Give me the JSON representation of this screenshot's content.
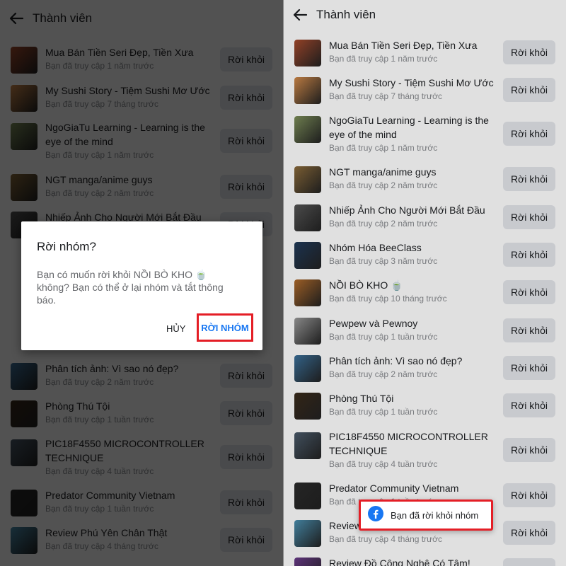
{
  "header": {
    "title": "Thành viên"
  },
  "leave_label": "Rời khỏi",
  "left_groups": [
    {
      "name": "Mua Bán Tiền Seri Đẹp, Tiền Xưa",
      "sub": "Bạn đã truy cập 1 năm trước",
      "thumb_color": "#a64a2c"
    },
    {
      "name": "My Sushi Story - Tiệm Sushi Mơ Ước",
      "sub": "Bạn đã truy cập 7 tháng trước",
      "thumb_color": "#d28a4a"
    },
    {
      "name": "NgoGiaTu Learning - Learning is the eye of the mind",
      "sub": "Bạn đã truy cập 1 năm trước",
      "thumb_color": "#7d8f5a"
    },
    {
      "name": "NGT manga/anime guys",
      "sub": "Bạn đã truy cập 2 năm trước",
      "thumb_color": "#8a6a3a"
    },
    {
      "name": "Nhiếp Ảnh Cho Người Mới Bắt Đầu",
      "sub": "",
      "thumb_color": "#555555"
    },
    {
      "name": "Phân tích ảnh: Vì sao nó đẹp?",
      "sub": "Bạn đã truy cập 2 năm trước",
      "thumb_color": "#3a6f9a"
    },
    {
      "name": "Phòng Thú Tội",
      "sub": "Bạn đã truy cập 1 tuần trước",
      "thumb_color": "#3a2a1a"
    },
    {
      "name": "PIC18F4550 MICROCONTROLLER TECHNIQUE",
      "sub": "Bạn đã truy cập 4 tuần trước",
      "thumb_color": "#4a5a6a"
    },
    {
      "name": "Predator Community Vietnam",
      "sub": "Bạn đã truy cập 1 tuần trước",
      "thumb_color": "#2a2a2a"
    },
    {
      "name": "Review Phú Yên Chân Thật",
      "sub": "Bạn đã truy cập 4 tháng trước",
      "thumb_color": "#4a8fb0"
    }
  ],
  "right_groups": [
    {
      "name": "Mua Bán Tiền Seri Đẹp, Tiền Xưa",
      "sub": "Bạn đã truy cập 1 năm trước",
      "thumb_color": "#a64a2c"
    },
    {
      "name": "My Sushi Story - Tiệm Sushi Mơ Ước",
      "sub": "Bạn đã truy cập 7 tháng trước",
      "thumb_color": "#d28a4a"
    },
    {
      "name": "NgoGiaTu Learning - Learning is the eye of the mind",
      "sub": "Bạn đã truy cập 1 năm trước",
      "thumb_color": "#7d8f5a"
    },
    {
      "name": "NGT manga/anime guys",
      "sub": "Bạn đã truy cập 2 năm trước",
      "thumb_color": "#8a6a3a"
    },
    {
      "name": "Nhiếp Ảnh Cho Người Mới Bắt Đầu",
      "sub": "Bạn đã truy cập 2 năm trước",
      "thumb_color": "#555555"
    },
    {
      "name": "Nhóm Hóa BeeClass",
      "sub": "Bạn đã truy cập 3 năm trước",
      "thumb_color": "#1f3a5a"
    },
    {
      "name": "NỒI BÒ KHO 🍵",
      "sub": "Bạn đã truy cập 10 tháng trước",
      "thumb_color": "#b06a2a"
    },
    {
      "name": "Pewpew và Pewnoy",
      "sub": "Bạn đã truy cập 1 tuần trước",
      "thumb_color": "#9a9a9a"
    },
    {
      "name": "Phân tích ảnh: Vì sao nó đẹp?",
      "sub": "Bạn đã truy cập 2 năm trước",
      "thumb_color": "#3a6f9a"
    },
    {
      "name": "Phòng Thú Tội",
      "sub": "Bạn đã truy cập 1 tuần trước",
      "thumb_color": "#3a2a1a"
    },
    {
      "name": "PIC18F4550 MICROCONTROLLER TECHNIQUE",
      "sub": "Bạn đã truy cập 4 tuần trước",
      "thumb_color": "#4a5a6a"
    },
    {
      "name": "Predator Community Vietnam",
      "sub": "Bạn đã truy cập 1 tuần trước",
      "thumb_color": "#2a2a2a"
    },
    {
      "name": "Review Phú Yên Chân Thật",
      "sub": "Bạn đã truy cập 4 tháng trước",
      "thumb_color": "#4a8fb0"
    },
    {
      "name": "Review Đồ Công Nghệ Có Tâm!",
      "sub": "",
      "thumb_color": "#6a3a8a"
    }
  ],
  "dialog": {
    "title": "Rời nhóm?",
    "body": "Bạn có muốn rời khỏi NỒI BÒ KHO 🍵 không? Bạn có thể ở lại nhóm và tắt thông báo.",
    "cancel": "HỦY",
    "confirm": "RỜI NHÓM"
  },
  "toast": {
    "text": "Bạn đã rời khỏi nhóm",
    "icon": "facebook-icon"
  }
}
